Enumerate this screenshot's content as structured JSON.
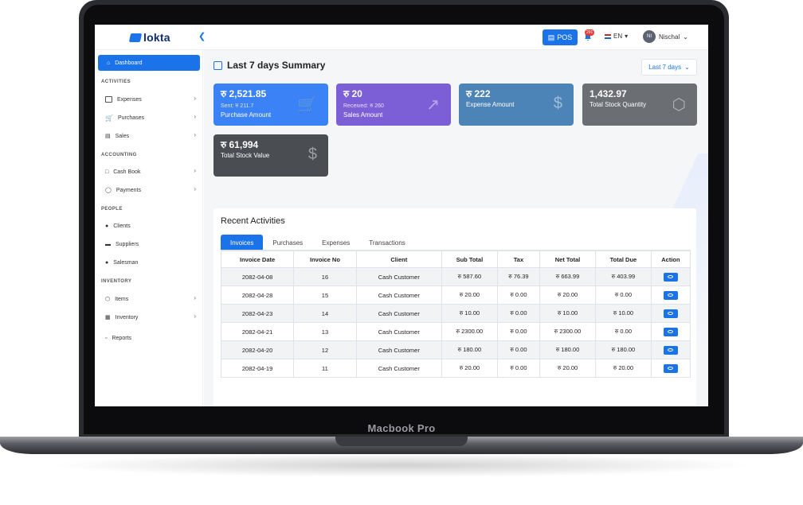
{
  "device": {
    "label": "Macbook Pro"
  },
  "topbar": {
    "logo_text": "lokta",
    "pos_label": "POS",
    "notification_count": "291",
    "language": "EN",
    "user_initials": "NI",
    "user_name": "Nischal"
  },
  "sidebar": {
    "active": "Dashboard",
    "sections": [
      {
        "title": "ACTIVITIES",
        "items": [
          "Expenses",
          "Purchases",
          "Sales"
        ]
      },
      {
        "title": "ACCOUNTING",
        "items": [
          "Cash Book",
          "Payments"
        ]
      },
      {
        "title": "PEOPLE",
        "items": [
          "Clients",
          "Suppliers",
          "Salesman"
        ]
      },
      {
        "title": "INVENTORY",
        "items": [
          "Items",
          "Inventory",
          "Reports"
        ]
      }
    ]
  },
  "summary": {
    "title": "Last 7 days Summary",
    "range": "Last 7 days",
    "cards": [
      {
        "value": "रु 2,521.85",
        "sub": "Sent: रु 211.7",
        "label": "Purchase Amount",
        "icon": "cart-icon",
        "color": "#3b82f6"
      },
      {
        "value": "रु 20",
        "sub": "Received: रु 260",
        "label": "Sales Amount",
        "icon": "trend-up-icon",
        "color": "#7c5fd6"
      },
      {
        "value": "रु 222",
        "sub": "",
        "label": "Expense Amount",
        "icon": "receipt-icon",
        "color": "#4d84b8"
      },
      {
        "value": "1,432.97",
        "sub": "",
        "label": "Total Stock Quantity",
        "icon": "box-icon",
        "color": "#6b6e73"
      },
      {
        "value": "रु 61,994",
        "sub": "",
        "label": "Total Stock Value",
        "icon": "dollar-icon",
        "color": "#4a4d52"
      }
    ]
  },
  "activities": {
    "title": "Recent Activities",
    "tabs": [
      "Invoices",
      "Purchases",
      "Expenses",
      "Transactions"
    ],
    "columns": [
      "Invoice Date",
      "Invoice No",
      "Client",
      "Sub Total",
      "Tax",
      "Net Total",
      "Total Due",
      "Action"
    ],
    "rows": [
      [
        "2082-04-08",
        "16",
        "Cash Customer",
        "रु 587.60",
        "रु 76.39",
        "रु 663.99",
        "रु 403.99"
      ],
      [
        "2082-04-28",
        "15",
        "Cash Customer",
        "रु 20.00",
        "रु 0.00",
        "रु 20.00",
        "रु 0.00"
      ],
      [
        "2082-04-23",
        "14",
        "Cash Customer",
        "रु 10.00",
        "रु 0.00",
        "रु 10.00",
        "रु 10.00"
      ],
      [
        "2082-04-21",
        "13",
        "Cash Customer",
        "रु 2300.00",
        "रु 0.00",
        "रु 2300.00",
        "रु 0.00"
      ],
      [
        "2082-04-20",
        "12",
        "Cash Customer",
        "रु 180.00",
        "रु 0.00",
        "रु 180.00",
        "रु 180.00"
      ],
      [
        "2082-04-19",
        "11",
        "Cash Customer",
        "रु 20.00",
        "रु 0.00",
        "रु 20.00",
        "रु 20.00"
      ]
    ]
  }
}
